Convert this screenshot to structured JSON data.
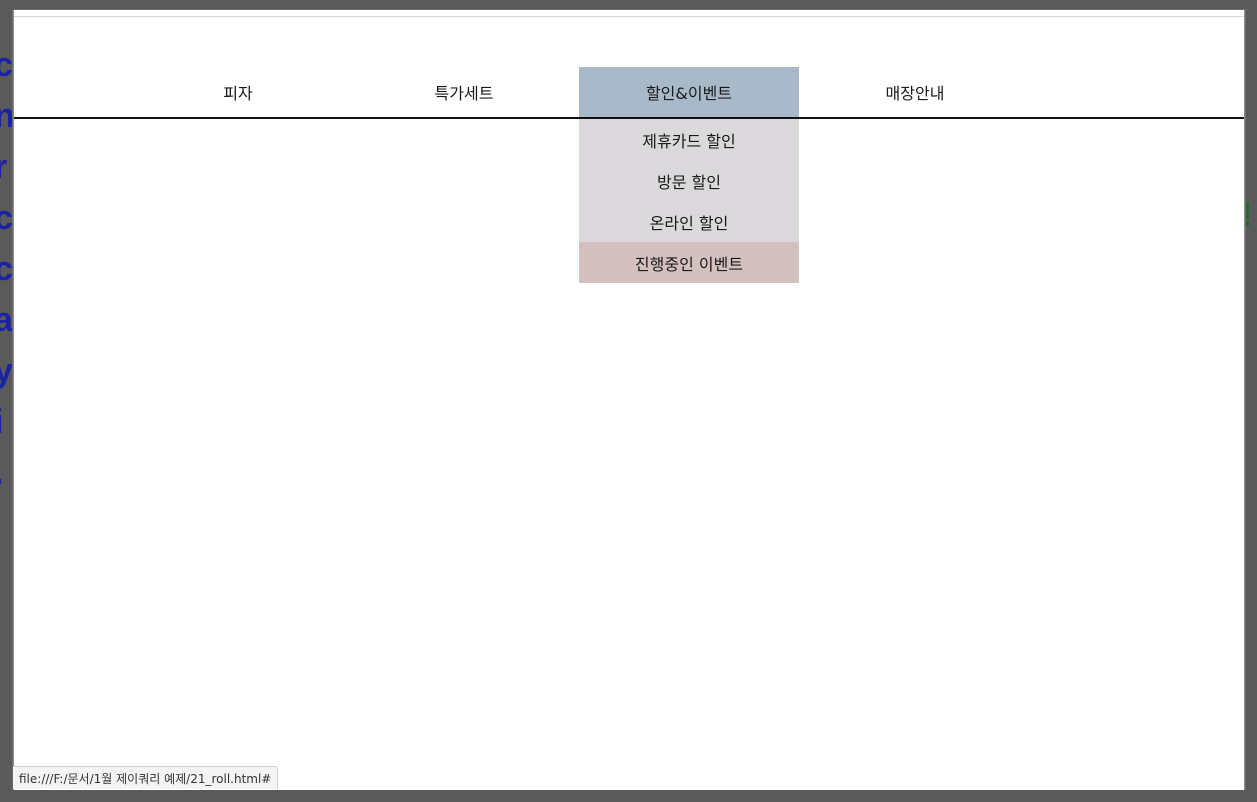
{
  "nav": {
    "items": [
      {
        "label": "피자"
      },
      {
        "label": "특가세트"
      },
      {
        "label": "할인&이벤트"
      },
      {
        "label": "매장안내"
      }
    ]
  },
  "submenu": {
    "items": [
      {
        "label": "제휴카드 할인"
      },
      {
        "label": "방문 할인"
      },
      {
        "label": "온라인 할인"
      },
      {
        "label": "진행중인 이벤트"
      }
    ]
  },
  "status": {
    "url": "file:///F:/문서/1월 제이쿼리 예제/21_roll.html#"
  },
  "colors": {
    "active_tab": "#a8b9ca",
    "submenu_bg": "#dcd9dd",
    "submenu_hover": "#d4c0bf",
    "underline": "#111111"
  }
}
